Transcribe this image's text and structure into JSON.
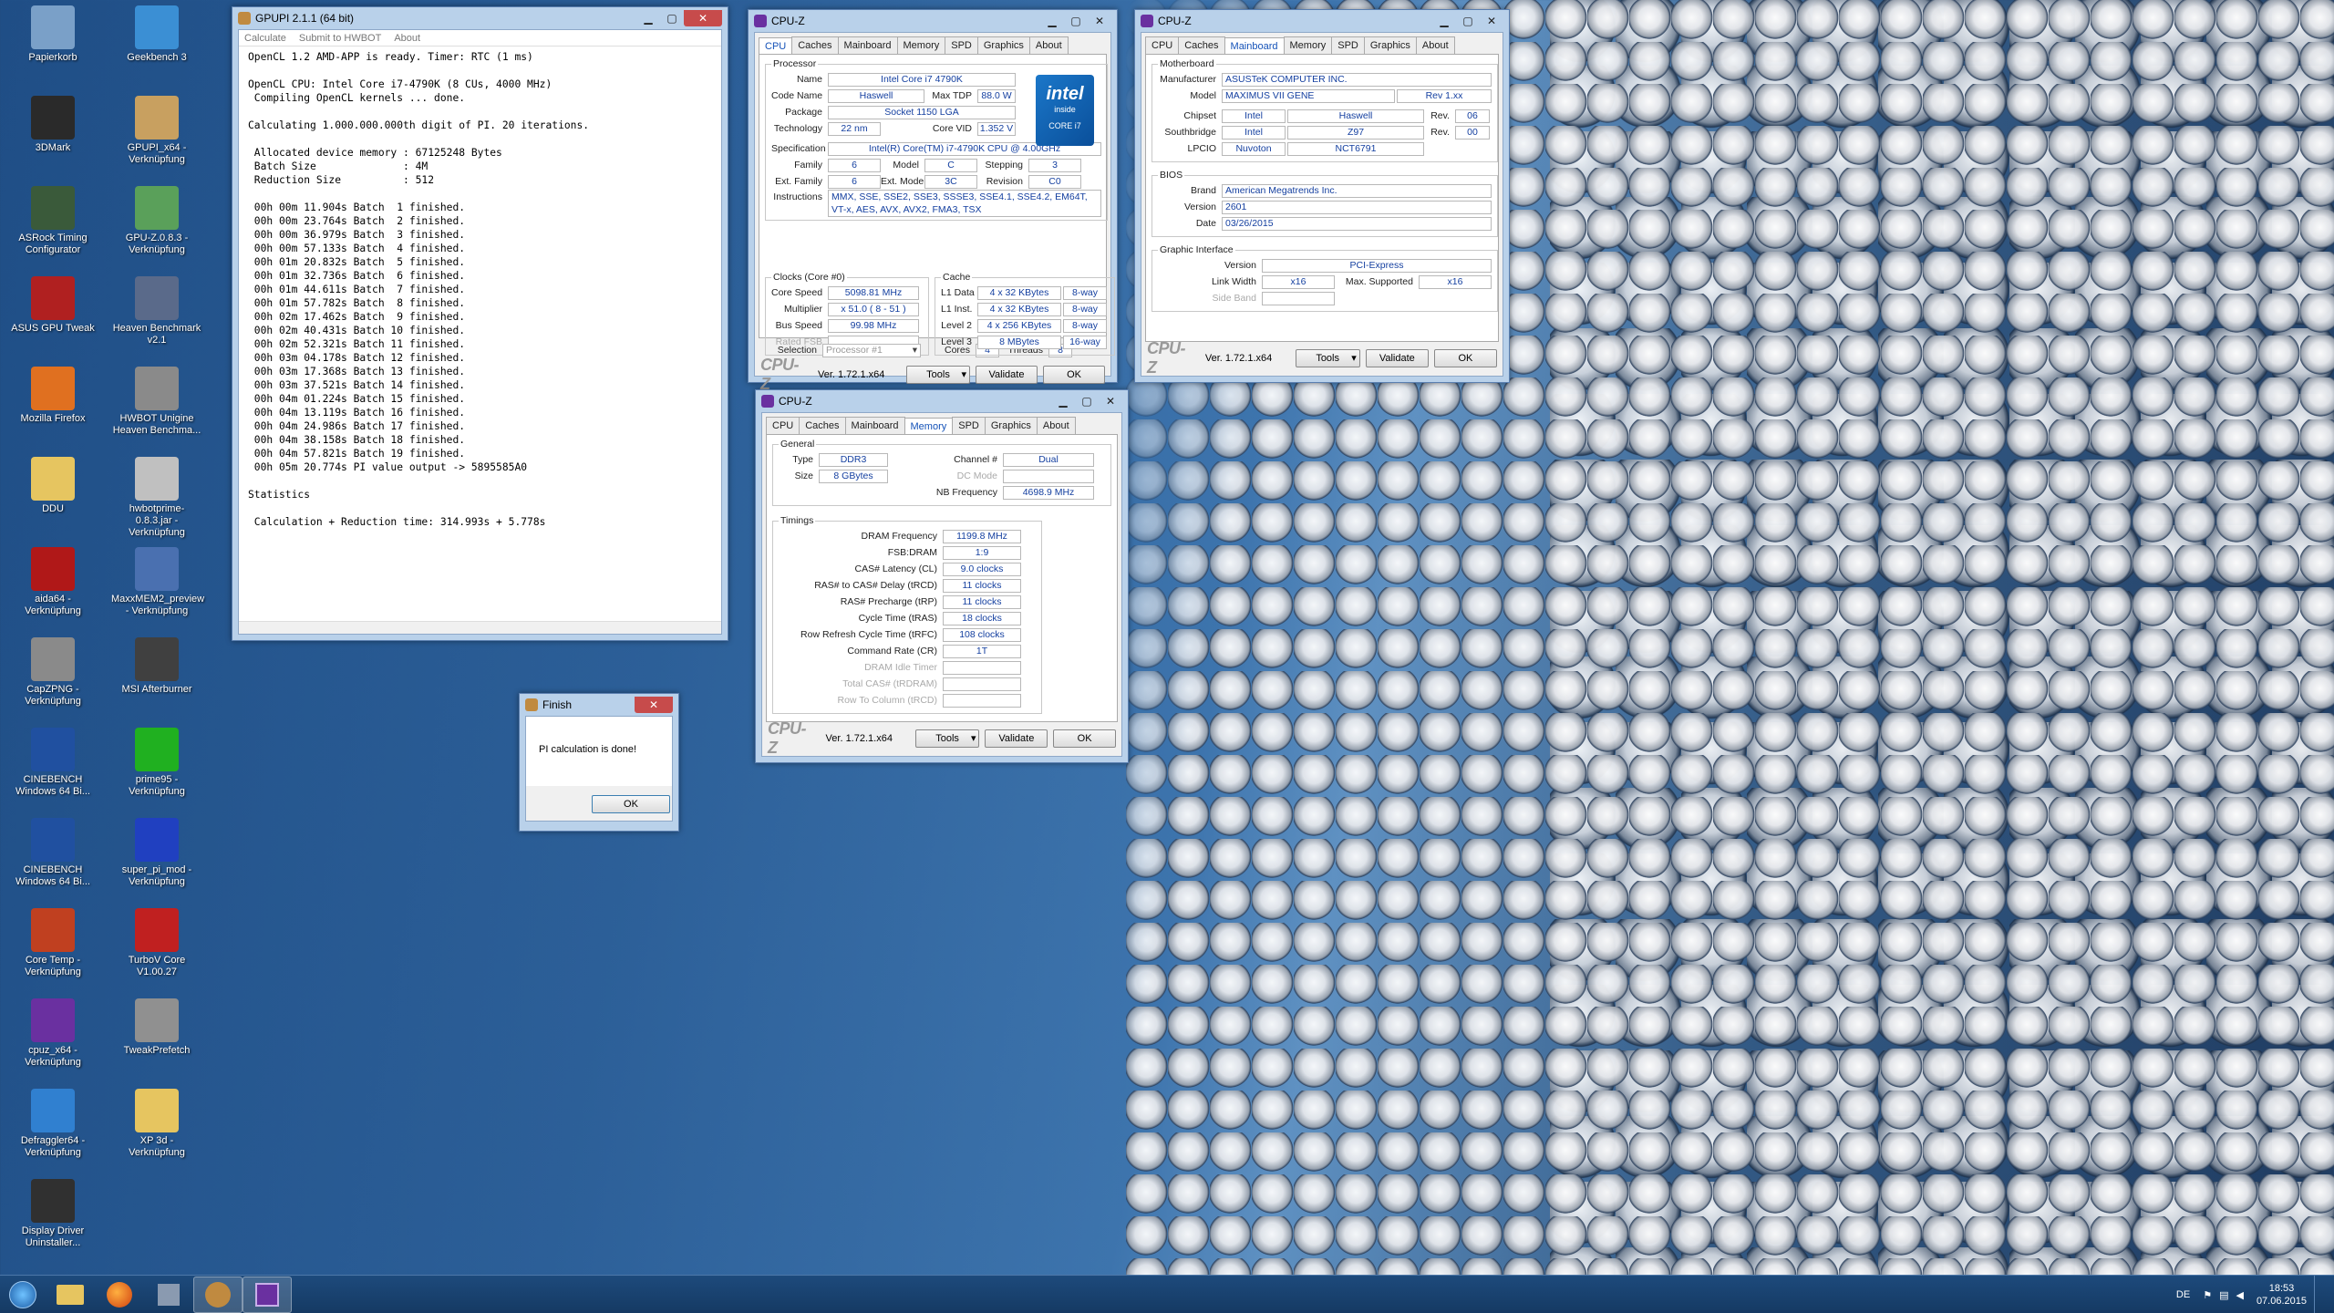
{
  "desktop_icons": [
    {
      "label": "Papierkorb",
      "icon": "recycle-bin-icon",
      "color": "#7aa0c8"
    },
    {
      "label": "Geekbench 3",
      "icon": "geekbench-icon",
      "color": "#3b8fd4"
    },
    {
      "label": "3DMark",
      "icon": "3dmark-icon",
      "color": "#2a2a2a"
    },
    {
      "label": "GPUPI_x64 - Verknüpfung",
      "icon": "gpupi-icon",
      "color": "#c8a060"
    },
    {
      "label": "ASRock Timing Configurator",
      "icon": "asrock-icon",
      "color": "#3a5a3a"
    },
    {
      "label": "GPU-Z.0.8.3 - Verknüpfung",
      "icon": "gpuz-icon",
      "color": "#5aa05a"
    },
    {
      "label": "ASUS GPU Tweak",
      "icon": "asus-gpu-tweak-icon",
      "color": "#b02020"
    },
    {
      "label": "Heaven Benchmark v2.1",
      "icon": "heaven-icon",
      "color": "#5a6a8a"
    },
    {
      "label": "Mozilla Firefox",
      "icon": "firefox-icon",
      "color": "#e07020"
    },
    {
      "label": "HWBOT Unigine Heaven Benchma...",
      "icon": "hwbot-heaven-icon",
      "color": "#8a8a8a"
    },
    {
      "label": "DDU",
      "icon": "folder-icon",
      "color": "#e6c560"
    },
    {
      "label": "hwbotprime-0.8.3.jar - Verknüpfung",
      "icon": "java-icon",
      "color": "#c0c0c0"
    },
    {
      "label": "aida64 - Verknüpfung",
      "icon": "aida64-icon",
      "color": "#b01818"
    },
    {
      "label": "MaxxMEM2_preview - Verknüpfung",
      "icon": "maxxmem-icon",
      "color": "#4a70b0"
    },
    {
      "label": "CapZPNG - Verknüpfung",
      "icon": "capzpng-icon",
      "color": "#8a8a8a"
    },
    {
      "label": "MSI Afterburner",
      "icon": "msi-afterburner-icon",
      "color": "#404040"
    },
    {
      "label": "CINEBENCH Windows 64 Bi...",
      "icon": "cinebench-icon",
      "color": "#2050a0"
    },
    {
      "label": "prime95 - Verknüpfung",
      "icon": "prime95-icon",
      "color": "#20b020"
    },
    {
      "label": "CINEBENCH Windows 64 Bi...",
      "icon": "cinebench-icon",
      "color": "#2050a0"
    },
    {
      "label": "super_pi_mod - Verknüpfung",
      "icon": "superpi-icon",
      "color": "#2040c0"
    },
    {
      "label": "Core Temp - Verknüpfung",
      "icon": "coretemp-icon",
      "color": "#c04020"
    },
    {
      "label": "TurboV Core V1.00.27",
      "icon": "turbov-icon",
      "color": "#c02020"
    },
    {
      "label": "cpuz_x64 - Verknüpfung",
      "icon": "cpuz-icon",
      "color": "#6a30a0"
    },
    {
      "label": "TweakPrefetch",
      "icon": "tweakprefetch-icon",
      "color": "#909090"
    },
    {
      "label": "Defraggler64 - Verknüpfung",
      "icon": "defraggler-icon",
      "color": "#3080d0"
    },
    {
      "label": "XP 3d - Verknüpfung",
      "icon": "folder-icon",
      "color": "#e6c560"
    },
    {
      "label": "Display Driver Uninstaller...",
      "icon": "ddu-icon",
      "color": "#303030"
    }
  ],
  "gpupi": {
    "title": "GPUPI 2.1.1 (64 bit)",
    "menu": [
      "Calculate",
      "Submit to HWBOT",
      "About"
    ],
    "lines": [
      "OpenCL 1.2 AMD-APP is ready. Timer: RTC (1 ms)",
      "",
      "OpenCL CPU: Intel Core i7-4790K (8 CUs, 4000 MHz)",
      " Compiling OpenCL kernels ... done.",
      "",
      "Calculating 1.000.000.000th digit of PI. 20 iterations.",
      "",
      " Allocated device memory : 67125248 Bytes",
      " Batch Size              : 4M",
      " Reduction Size          : 512",
      "",
      " 00h 00m 11.904s Batch  1 finished.",
      " 00h 00m 23.764s Batch  2 finished.",
      " 00h 00m 36.979s Batch  3 finished.",
      " 00h 00m 57.133s Batch  4 finished.",
      " 00h 01m 20.832s Batch  5 finished.",
      " 00h 01m 32.736s Batch  6 finished.",
      " 00h 01m 44.611s Batch  7 finished.",
      " 00h 01m 57.782s Batch  8 finished.",
      " 00h 02m 17.462s Batch  9 finished.",
      " 00h 02m 40.431s Batch 10 finished.",
      " 00h 02m 52.321s Batch 11 finished.",
      " 00h 03m 04.178s Batch 12 finished.",
      " 00h 03m 17.368s Batch 13 finished.",
      " 00h 03m 37.521s Batch 14 finished.",
      " 00h 04m 01.224s Batch 15 finished.",
      " 00h 04m 13.119s Batch 16 finished.",
      " 00h 04m 24.986s Batch 17 finished.",
      " 00h 04m 38.158s Batch 18 finished.",
      " 00h 04m 57.821s Batch 19 finished.",
      " 00h 05m 20.774s PI value output -> 5895585A0",
      "",
      "Statistics",
      "",
      " Calculation + Reduction time: 314.993s + 5.778s"
    ]
  },
  "finish": {
    "title": "Finish",
    "message": "PI calculation is done!",
    "ok": "OK"
  },
  "cpuz_tabs": [
    "CPU",
    "Caches",
    "Mainboard",
    "Memory",
    "SPD",
    "Graphics",
    "About"
  ],
  "cpuz_common": {
    "title": "CPU-Z",
    "version": "Ver. 1.72.1.x64",
    "tools": "Tools",
    "validate": "Validate",
    "ok": "OK",
    "logo": "CPU-Z"
  },
  "cpu": {
    "processor_legend": "Processor",
    "name_l": "Name",
    "name": "Intel Core i7 4790K",
    "codename_l": "Code Name",
    "codename": "Haswell",
    "maxtdp_l": "Max TDP",
    "maxtdp": "88.0 W",
    "package_l": "Package",
    "package": "Socket 1150 LGA",
    "tech_l": "Technology",
    "tech": "22 nm",
    "vid_l": "Core VID",
    "vid": "1.352 V",
    "spec_l": "Specification",
    "spec": "Intel(R) Core(TM) i7-4790K CPU @ 4.00GHz",
    "family_l": "Family",
    "family": "6",
    "model_l": "Model",
    "model": "C",
    "stepping_l": "Stepping",
    "stepping": "3",
    "extfamily_l": "Ext. Family",
    "extfamily": "6",
    "extmodel_l": "Ext. Model",
    "extmodel": "3C",
    "revision_l": "Revision",
    "revision": "C0",
    "instr_l": "Instructions",
    "instr1": "MMX, SSE, SSE2, SSE3, SSSE3, SSE4.1, SSE4.2, EM64T,",
    "instr2": "VT-x, AES, AVX, AVX2, FMA3, TSX",
    "clocks_legend": "Clocks (Core #0)",
    "corespeed_l": "Core Speed",
    "corespeed": "5098.81 MHz",
    "mult_l": "Multiplier",
    "mult": "x 51.0 ( 8 - 51 )",
    "bus_l": "Bus Speed",
    "bus": "99.98 MHz",
    "fsb_l": "Rated FSB",
    "fsb": "",
    "cache_legend": "Cache",
    "l1d_l": "L1 Data",
    "l1d": "4 x 32 KBytes",
    "l1d_w": "8-way",
    "l1i_l": "L1 Inst.",
    "l1i": "4 x 32 KBytes",
    "l1i_w": "8-way",
    "l2_l": "Level 2",
    "l2": "4 x 256 KBytes",
    "l2_w": "8-way",
    "l3_l": "Level 3",
    "l3": "8 MBytes",
    "l3_w": "16-way",
    "sel_l": "Selection",
    "sel": "Processor #1",
    "cores_l": "Cores",
    "cores": "4",
    "threads_l": "Threads",
    "threads": "8",
    "intel_brand": "intel",
    "intel_inside": "inside",
    "intel_core": "CORE i7"
  },
  "mainboard": {
    "mb_legend": "Motherboard",
    "manu_l": "Manufacturer",
    "manu": "ASUSTeK COMPUTER INC.",
    "model_l": "Model",
    "model": "MAXIMUS VII GENE",
    "model_rev": "Rev 1.xx",
    "chipset_l": "Chipset",
    "chipset_v": "Intel",
    "chipset": "Haswell",
    "chipset_rev_l": "Rev.",
    "chipset_rev": "06",
    "south_l": "Southbridge",
    "south_v": "Intel",
    "south": "Z97",
    "south_rev_l": "Rev.",
    "south_rev": "00",
    "lpcio_l": "LPCIO",
    "lpcio_v": "Nuvoton",
    "lpcio": "NCT6791",
    "bios_legend": "BIOS",
    "brand_l": "Brand",
    "brand": "American Megatrends Inc.",
    "ver_l": "Version",
    "ver": "2601",
    "date_l": "Date",
    "date": "03/26/2015",
    "gi_legend": "Graphic Interface",
    "giver_l": "Version",
    "giver": "PCI-Express",
    "lw_l": "Link Width",
    "lw": "x16",
    "ms_l": "Max. Supported",
    "ms": "x16",
    "sb_l": "Side Band",
    "sb": ""
  },
  "memory": {
    "gen_legend": "General",
    "type_l": "Type",
    "type": "DDR3",
    "channel_l": "Channel #",
    "channel": "Dual",
    "size_l": "Size",
    "size": "8 GBytes",
    "dc_l": "DC Mode",
    "dc": "",
    "nb_l": "NB Frequency",
    "nb": "4698.9 MHz",
    "tim_legend": "Timings",
    "timings": [
      {
        "l": "DRAM Frequency",
        "v": "1199.8 MHz",
        "dim": false
      },
      {
        "l": "FSB:DRAM",
        "v": "1:9",
        "dim": false
      },
      {
        "l": "CAS# Latency (CL)",
        "v": "9.0 clocks",
        "dim": false
      },
      {
        "l": "RAS# to CAS# Delay (tRCD)",
        "v": "11 clocks",
        "dim": false
      },
      {
        "l": "RAS# Precharge (tRP)",
        "v": "11 clocks",
        "dim": false
      },
      {
        "l": "Cycle Time (tRAS)",
        "v": "18 clocks",
        "dim": false
      },
      {
        "l": "Row Refresh Cycle Time (tRFC)",
        "v": "108 clocks",
        "dim": false
      },
      {
        "l": "Command Rate (CR)",
        "v": "1T",
        "dim": false
      },
      {
        "l": "DRAM Idle Timer",
        "v": "",
        "dim": true
      },
      {
        "l": "Total CAS# (tRDRAM)",
        "v": "",
        "dim": true
      },
      {
        "l": "Row To Column (tRCD)",
        "v": "",
        "dim": true
      }
    ]
  },
  "tray": {
    "lang": "DE",
    "time": "18:53",
    "date": "07.06.2015"
  }
}
